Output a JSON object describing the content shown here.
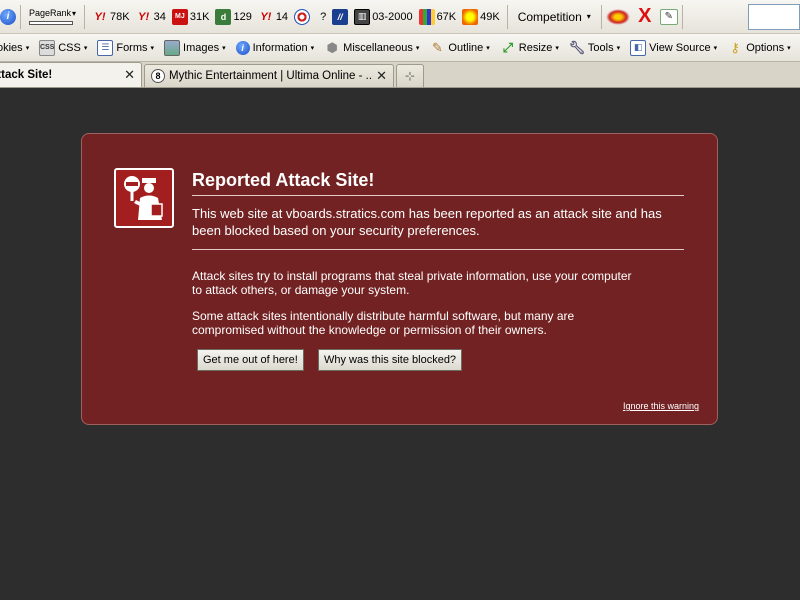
{
  "toolbar1": {
    "pagerank_label": "PageRank",
    "pagerank_fill_pct": 0,
    "stats": [
      {
        "icon": "yahoo-icon",
        "value": "78K"
      },
      {
        "icon": "yahoo-icon",
        "value": "34"
      },
      {
        "icon": "majestic-seo-icon",
        "value": "31K"
      },
      {
        "icon": "delicious-icon",
        "value": "129"
      },
      {
        "icon": "yahoo-icon",
        "value": "14"
      },
      {
        "icon": "target-icon",
        "value": "?"
      },
      {
        "icon": "archive-icon",
        "value": ""
      },
      {
        "icon": "calendar-icon",
        "value": "03-2000"
      },
      {
        "icon": "bars-icon",
        "value": "67K"
      },
      {
        "icon": "sun-icon",
        "value": "49K"
      }
    ],
    "competition_label": "Competition"
  },
  "toolbar2": {
    "items": [
      "okies",
      "CSS",
      "Forms",
      "Images",
      "Information",
      "Miscellaneous",
      "Outline",
      "Resize",
      "Tools",
      "View Source",
      "Options"
    ]
  },
  "tabs": {
    "active_label": "Attack Site!",
    "inactive_label": "Mythic Entertainment | Ultima Online - ...",
    "close_glyph": "✕",
    "newtab_glyph": "⊹"
  },
  "warning": {
    "title": "Reported Attack Site!",
    "paragraph1": "This web site at vboards.stratics.com has been reported as an attack site and has been blocked based on your security preferences.",
    "paragraph2": "Attack sites try to install programs that steal private information, use your computer to attack others, or damage your system.",
    "paragraph3": "Some attack sites intentionally distribute harmful software, but many are compromised without the knowledge or permission of their owners.",
    "button_get_out": "Get me out of here!",
    "button_why": "Why was this site blocked?",
    "ignore_link": "Ignore this warning"
  },
  "colors": {
    "panel_bg": "#722222",
    "page_bg": "#2d2d2d"
  }
}
